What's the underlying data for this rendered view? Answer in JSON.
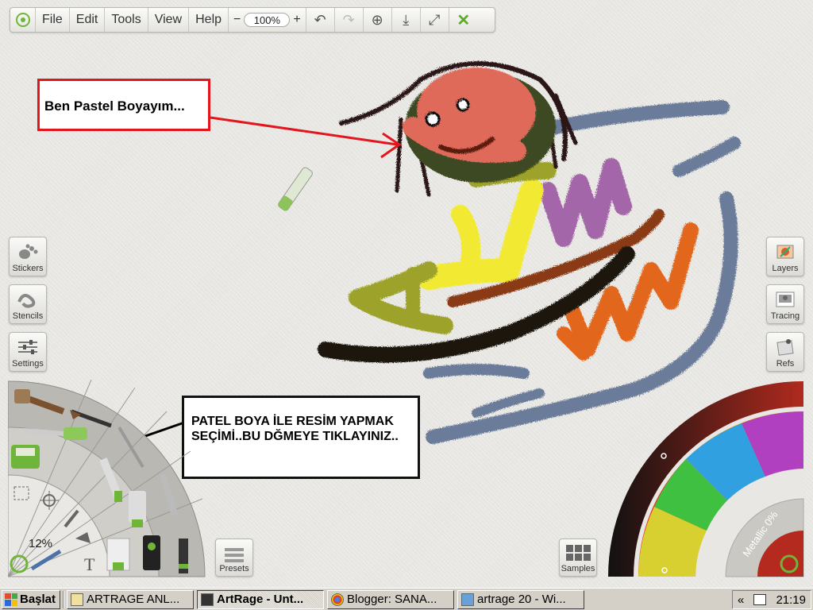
{
  "menu": {
    "items": [
      "File",
      "Edit",
      "Tools",
      "View",
      "Help"
    ],
    "zoom_minus": "−",
    "zoom_value": "100%",
    "zoom_plus": "+"
  },
  "side_panels": {
    "stickers": "Stickers",
    "stencils": "Stencils",
    "settings": "Settings",
    "layers": "Layers",
    "tracing": "Tracing",
    "refs": "Refs"
  },
  "annotations": {
    "top_note": "Ben Pastel Boyayım...",
    "bottom_note": "PATEL BOYA İLE RESİM YAPMAK SEÇİMİ..BU DĞMEYE TIKLAYINIZ.."
  },
  "tool_wheel": {
    "size_value": "12%"
  },
  "color_wheel": {
    "metallic_label": "Metallic 0%"
  },
  "bottom_buttons": {
    "presets": "Presets",
    "samples": "Samples"
  },
  "taskbar": {
    "start_label": "Başlat",
    "tasks": [
      {
        "label": "ARTRAGE ANL...",
        "active": false
      },
      {
        "label": "ArtRage - Unt...",
        "active": true
      },
      {
        "label": "Blogger: SANA...",
        "active": false
      },
      {
        "label": "artrage 20 - Wi...",
        "active": false
      }
    ],
    "tray_chevron": "«",
    "clock": "21:19"
  },
  "colors": {
    "accent_green": "#6fb53a",
    "annotation_red": "#e2161c",
    "taskbar_gray": "#d4d0c8"
  }
}
